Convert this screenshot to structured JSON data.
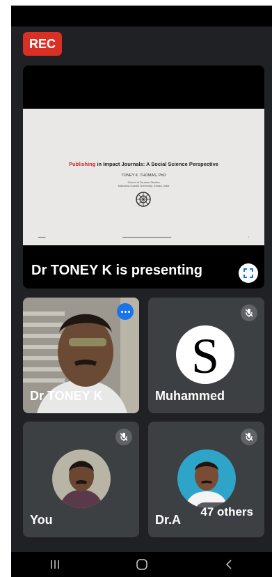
{
  "recording": {
    "label": "REC",
    "color": "#d93025"
  },
  "presentation": {
    "slide": {
      "title_highlight": "Publishing",
      "title_rest": " in Impact Journals: A Social Science Perspective",
      "author": "TONEY K. THOMAS, PhD",
      "institution_line1": "School of Tourism Studies",
      "institution_line2": "Mahatma Gandhi University, Kerala, India"
    },
    "presenter_label": "Dr TONEY K is presenting",
    "fullscreen_icon": "fullscreen-icon"
  },
  "participants": [
    {
      "name": "Dr TONEY K",
      "speaking": true,
      "muted": false
    },
    {
      "name": "Muhammed",
      "speaking": false,
      "muted": true
    },
    {
      "name": "You",
      "speaking": false,
      "muted": true
    },
    {
      "name": "Dr.A",
      "speaking": false,
      "muted": true
    }
  ],
  "others_count_label": "47 others",
  "colors": {
    "background": "#202124",
    "tile": "#3c4043",
    "speaking": "#1a73e8"
  },
  "navigation": [
    "recents-icon",
    "home-icon",
    "back-icon"
  ]
}
